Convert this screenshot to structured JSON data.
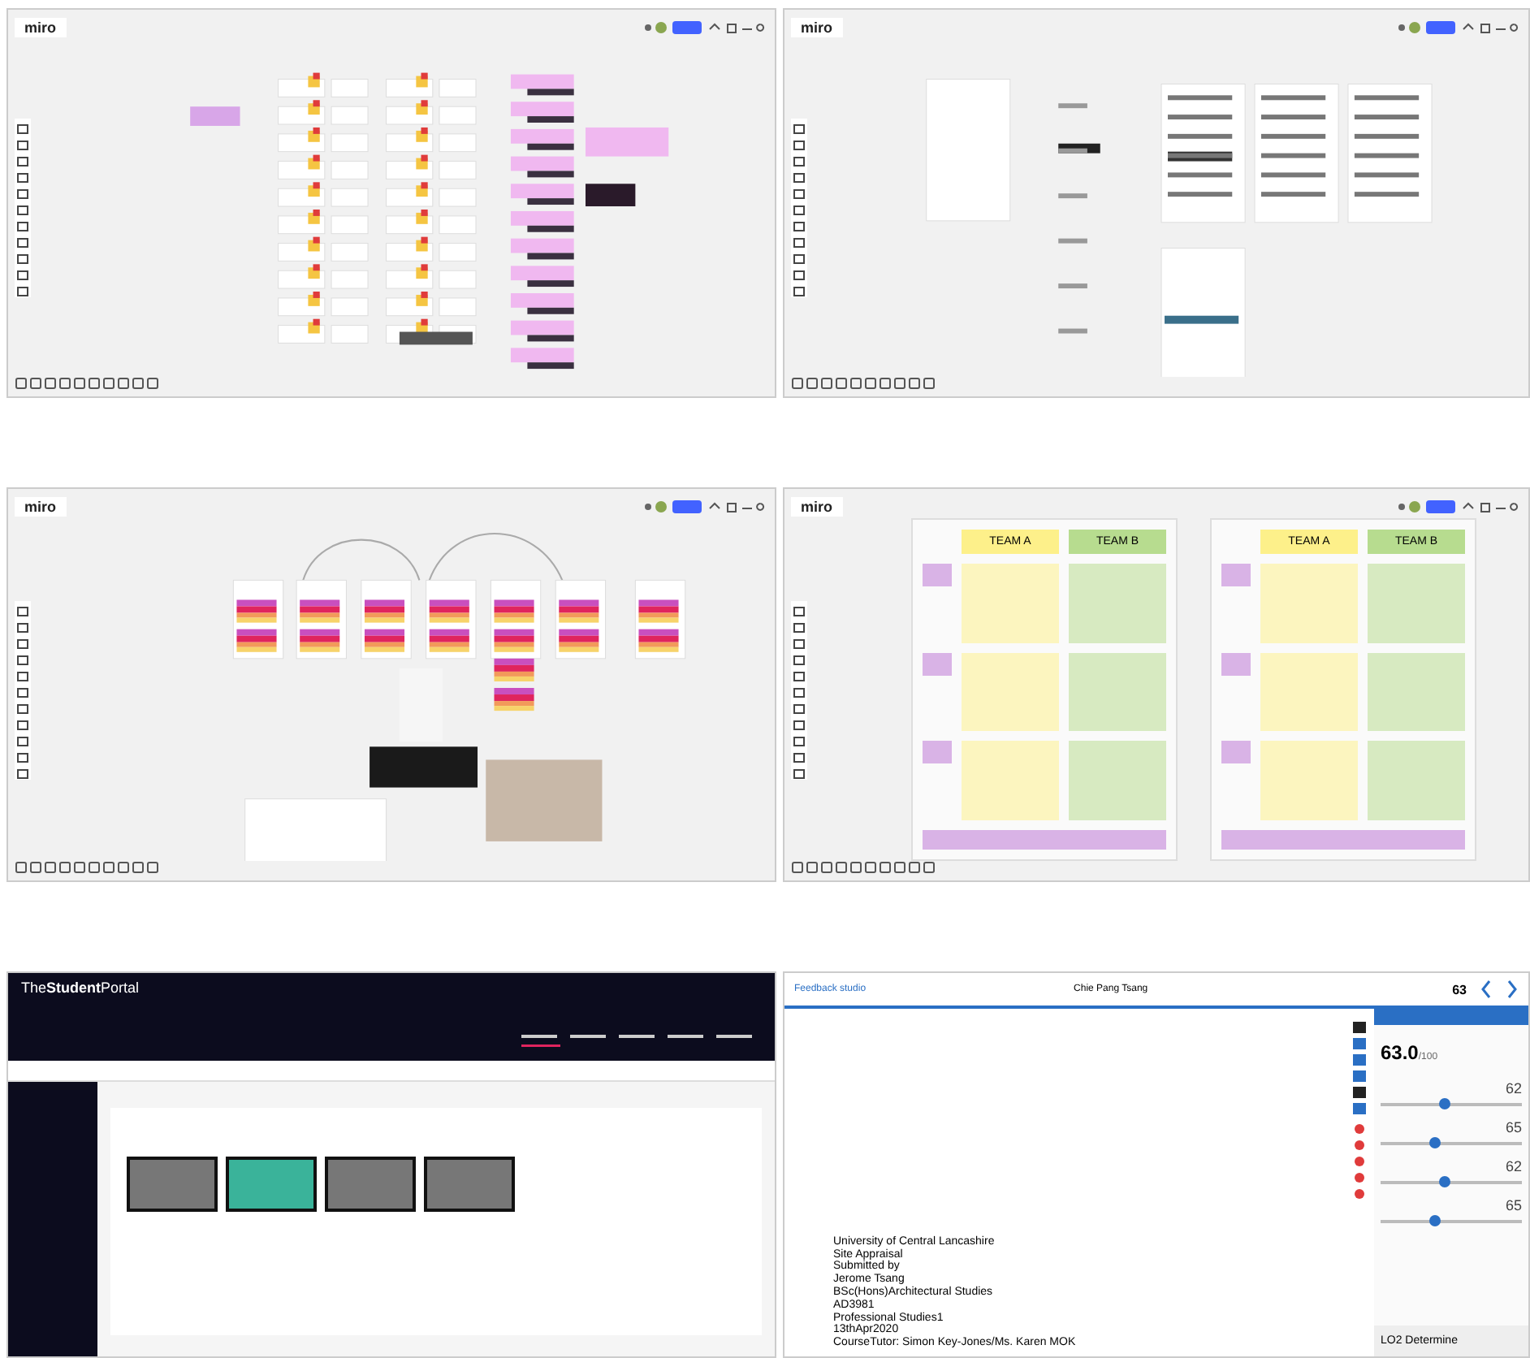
{
  "panels": [
    {
      "kind": "miro",
      "logo": "miro",
      "board": {
        "kind": "cards"
      }
    },
    {
      "kind": "miro",
      "logo": "miro",
      "board": {
        "kind": "frames"
      }
    },
    {
      "kind": "miro",
      "logo": "miro",
      "board": {
        "kind": "stripes"
      }
    },
    {
      "kind": "miro",
      "logo": "miro",
      "board": {
        "kind": "teams"
      },
      "teams": [
        {
          "label": "TEAM A",
          "color": "#fdf08a"
        },
        {
          "label": "TEAM B",
          "color": "#b7dc8f"
        },
        {
          "label": "TEAM A",
          "color": "#fdf08a"
        },
        {
          "label": "TEAM B",
          "color": "#b7dc8f"
        }
      ]
    },
    {
      "kind": "portal",
      "logo": "The**Student**Portal"
    },
    {
      "kind": "feedback",
      "title": "Feedback studio",
      "student": "Chie Pang Tsang",
      "grade": "63",
      "document": [
        "University of Central Lancashire",
        "Site Appraisal",
        "Submitted by",
        "Jerome Tsang",
        "BSc(Hons)Architectural Studies",
        "AD3981",
        "Professional Studies1",
        "13thApr2020",
        "CourseTutor: Simon Key-Jones/Ms. Karen MOK"
      ],
      "score": "63.0",
      "out_of": "/100",
      "criteria": [
        {
          "score": "62",
          "level": 0.45
        },
        {
          "score": "65",
          "level": 0.38
        },
        {
          "score": "62",
          "level": 0.45
        },
        {
          "score": "65",
          "level": 0.38
        }
      ],
      "section": "LO2 Determine"
    }
  ]
}
